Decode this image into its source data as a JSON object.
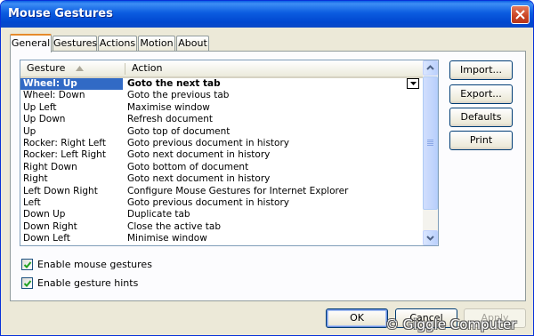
{
  "window": {
    "title": "Mouse Gestures"
  },
  "tabs": [
    {
      "label": "General"
    },
    {
      "label": "Gestures"
    },
    {
      "label": "Actions"
    },
    {
      "label": "Motion"
    },
    {
      "label": "About"
    }
  ],
  "table": {
    "columns": {
      "gesture": "Gesture",
      "action": "Action"
    },
    "rows": [
      {
        "gesture": "Wheel: Up",
        "action": "Goto the next tab",
        "selected": true
      },
      {
        "gesture": "Wheel: Down",
        "action": "Goto the previous tab"
      },
      {
        "gesture": "Up Left",
        "action": "Maximise window"
      },
      {
        "gesture": "Up Down",
        "action": "Refresh document"
      },
      {
        "gesture": "Up",
        "action": "Goto top of document"
      },
      {
        "gesture": "Rocker: Right Left",
        "action": "Goto previous document in history"
      },
      {
        "gesture": "Rocker: Left Right",
        "action": "Goto next document in history"
      },
      {
        "gesture": "Right Down",
        "action": "Goto bottom of document"
      },
      {
        "gesture": "Right",
        "action": "Goto next document in history"
      },
      {
        "gesture": "Left Down Right",
        "action": "Configure Mouse Gestures for Internet Explorer"
      },
      {
        "gesture": "Left",
        "action": "Goto previous document in history"
      },
      {
        "gesture": "Down Up",
        "action": "Duplicate tab"
      },
      {
        "gesture": "Down Right",
        "action": "Close the active tab"
      },
      {
        "gesture": "Down Left",
        "action": "Minimise window"
      }
    ]
  },
  "side_buttons": {
    "import": "Import...",
    "export": "Export...",
    "defaults": "Defaults",
    "print": "Print"
  },
  "checkboxes": {
    "enable_gestures": {
      "label": "Enable mouse gestures",
      "checked": true
    },
    "enable_hints": {
      "label": "Enable gesture hints",
      "checked": true
    }
  },
  "footer": {
    "ok": "OK",
    "cancel": "Cancel",
    "apply": "Apply"
  },
  "watermark": "© Giggle Computer"
}
